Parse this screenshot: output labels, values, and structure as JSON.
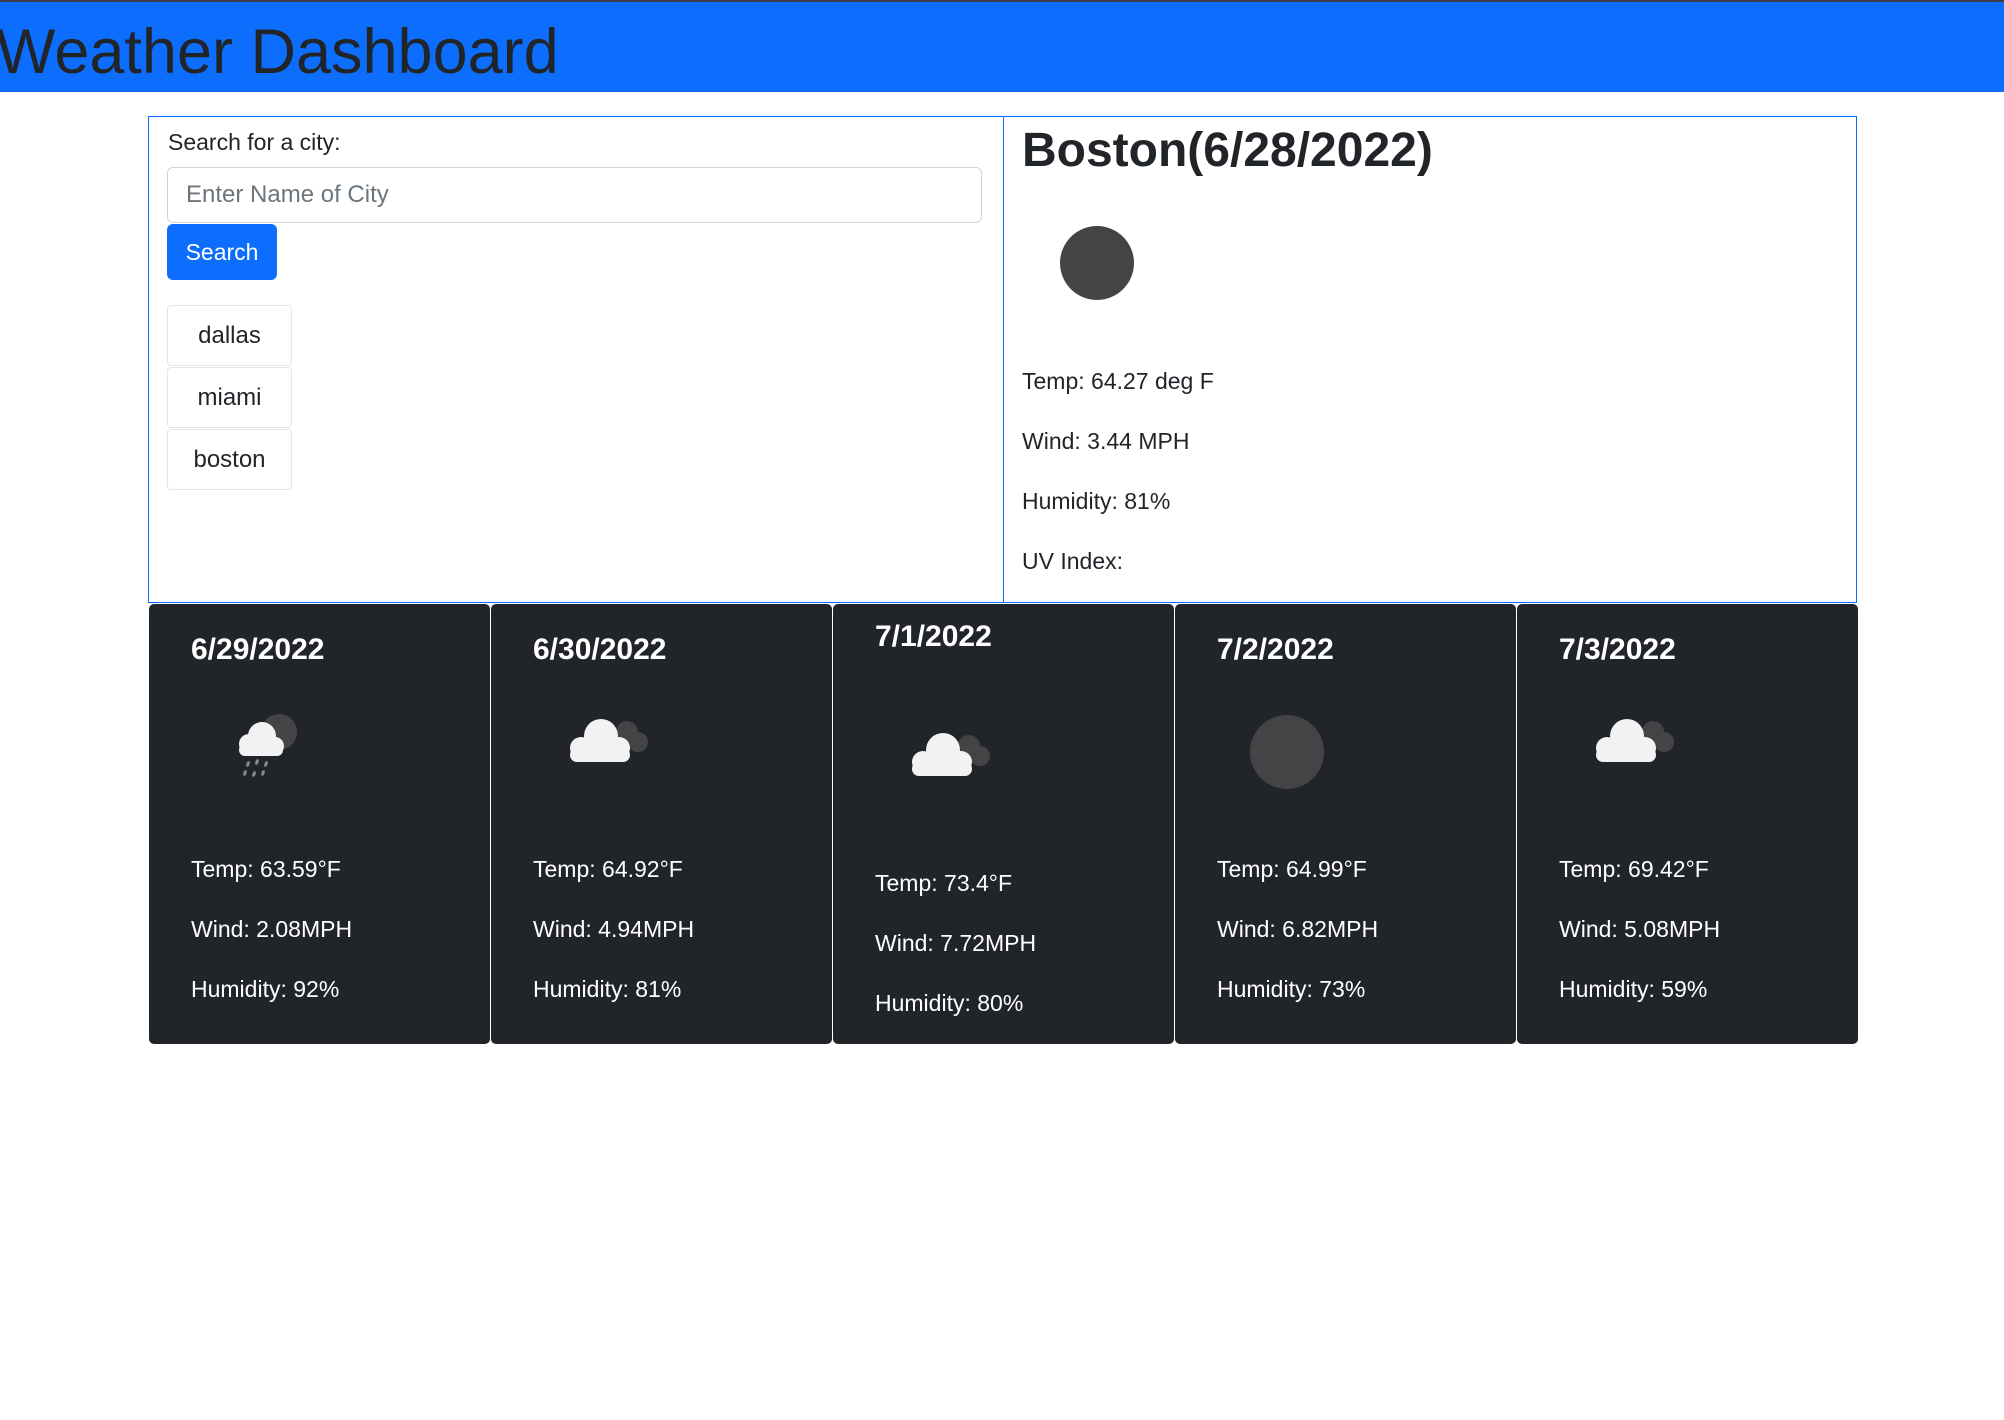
{
  "header": {
    "title": "Weather Dashboard"
  },
  "search": {
    "label": "Search for a city:",
    "placeholder": "Enter Name of City",
    "value": "",
    "button_label": "Search",
    "history": [
      "dallas",
      "miami",
      "boston"
    ]
  },
  "current": {
    "title": "Boston(6/28/2022)",
    "icon": "dark-circle-icon",
    "temp": "Temp: 64.27 deg F",
    "wind": "Wind: 3.44 MPH",
    "humidity": "Humidity: 81%",
    "uv": "UV Index:"
  },
  "forecast": [
    {
      "date": "6/29/2022",
      "icon": "rain-cloud-icon",
      "temp": "Temp: 63.59°F",
      "wind": "Wind: 2.08MPH",
      "humidity": "Humidity: 92%"
    },
    {
      "date": "6/30/2022",
      "icon": "broken-clouds-icon",
      "temp": "Temp: 64.92°F",
      "wind": "Wind: 4.94MPH",
      "humidity": "Humidity: 81%"
    },
    {
      "date": "7/1/2022",
      "icon": "broken-clouds-icon",
      "temp": "Temp: 73.4°F",
      "wind": "Wind: 7.72MPH",
      "humidity": "Humidity: 80%"
    },
    {
      "date": "7/2/2022",
      "icon": "dark-circle-icon",
      "temp": "Temp: 64.99°F",
      "wind": "Wind: 6.82MPH",
      "humidity": "Humidity: 73%"
    },
    {
      "date": "7/3/2022",
      "icon": "broken-clouds-icon",
      "temp": "Temp: 69.42°F",
      "wind": "Wind: 5.08MPH",
      "humidity": "Humidity: 59%"
    }
  ],
  "colors": {
    "header_bg": "#0d6efd",
    "button_bg": "#0d6efd",
    "panel_border": "#0d6efd",
    "card_bg": "#212529",
    "icon_dark": "#444446"
  }
}
